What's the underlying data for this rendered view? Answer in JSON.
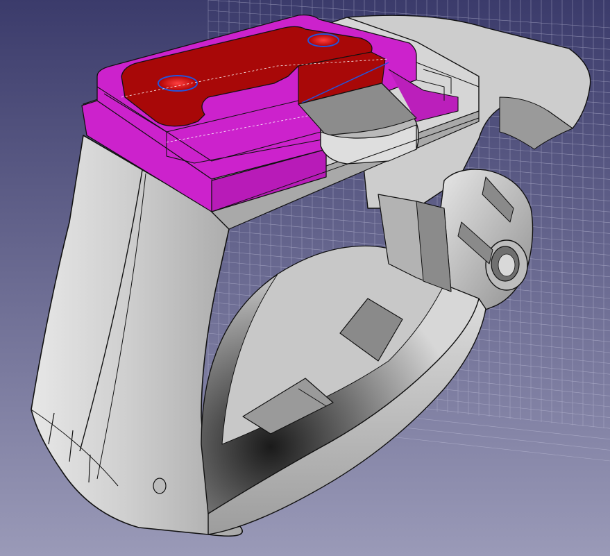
{
  "app": {
    "view": "3d-viewport",
    "background_top": "#3b3b6b",
    "background_bottom": "#9a9ab8"
  },
  "scene": {
    "model": "clamp-mount",
    "colors": {
      "body": "#c9c9c9",
      "body_shadow": "#7c7c7c",
      "body_highlight": "#f2f2f2",
      "edge": "#111111",
      "section_face": "#a80808",
      "section_wall": "#cc22cc",
      "section_wall_dark": "#9a119a",
      "hole": "#d41010",
      "hole_ring": "#2255dd",
      "grid": "#c4c4dd"
    },
    "icons": [
      "grid-plane-icon",
      "section-cut-icon"
    ]
  }
}
